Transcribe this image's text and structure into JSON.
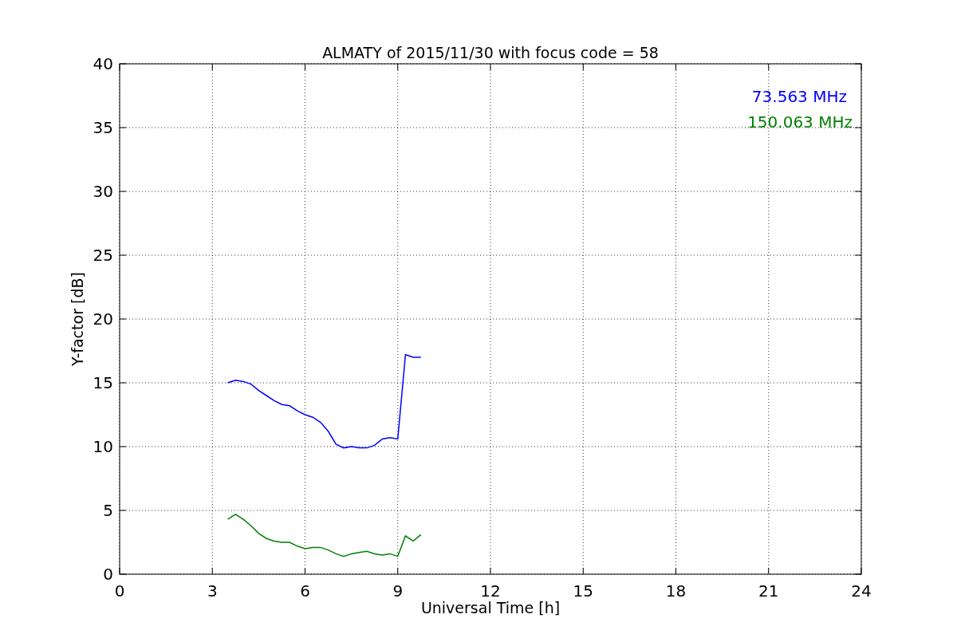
{
  "chart_data": {
    "type": "line",
    "title": "ALMATY of 2015/11/30 with focus code = 58",
    "xlabel": "Universal Time [h]",
    "ylabel": "Y-factor [dB]",
    "x": [
      3.5,
      3.75,
      4.0,
      4.25,
      4.5,
      4.75,
      5.0,
      5.25,
      5.5,
      5.75,
      6.0,
      6.25,
      6.5,
      6.75,
      7.0,
      7.25,
      7.5,
      7.75,
      8.0,
      8.25,
      8.5,
      8.75,
      9.0,
      9.25,
      9.5,
      9.75
    ],
    "series": [
      {
        "name": "73.563 MHz",
        "color": "#0000ff",
        "values": [
          15.0,
          15.2,
          15.1,
          14.9,
          14.4,
          14.0,
          13.6,
          13.3,
          13.2,
          12.8,
          12.5,
          12.3,
          11.9,
          11.2,
          10.2,
          9.9,
          10.0,
          9.9,
          9.9,
          10.1,
          10.6,
          10.7,
          10.6,
          17.2,
          17.0,
          17.0
        ]
      },
      {
        "name": "150.063 MHz",
        "color": "#008000",
        "values": [
          4.3,
          4.7,
          4.3,
          3.8,
          3.2,
          2.8,
          2.6,
          2.5,
          2.5,
          2.2,
          2.0,
          2.1,
          2.1,
          1.9,
          1.6,
          1.4,
          1.6,
          1.7,
          1.8,
          1.6,
          1.5,
          1.6,
          1.4,
          3.0,
          2.6,
          3.1
        ]
      }
    ],
    "xlim": [
      0,
      24
    ],
    "ylim": [
      0,
      40
    ],
    "xticks": [
      0,
      3,
      6,
      9,
      12,
      15,
      18,
      21,
      24
    ],
    "yticks": [
      0,
      5,
      10,
      15,
      20,
      25,
      30,
      35,
      40
    ],
    "grid": true
  }
}
